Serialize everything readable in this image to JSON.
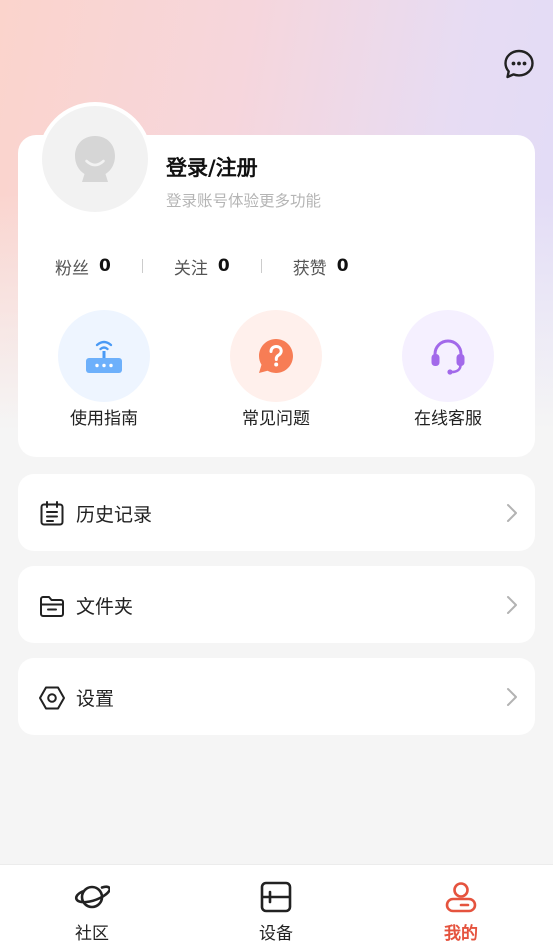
{
  "header": {
    "message_icon": "chat-bubble-icon"
  },
  "profile": {
    "title": "登录/注册",
    "subtitle": "登录账号体验更多功能",
    "avatar_icon": "default-avatar-icon",
    "stats": [
      {
        "label": "粉丝",
        "value": "0"
      },
      {
        "label": "关注",
        "value": "0"
      },
      {
        "label": "获赞",
        "value": "0"
      }
    ]
  },
  "quick_actions": [
    {
      "label": "使用指南",
      "icon": "router-icon",
      "bg": "#eef5ff",
      "color": "#4a9af5"
    },
    {
      "label": "常见问题",
      "icon": "question-bubble-icon",
      "bg": "#fff0ec",
      "color": "#f77d55"
    },
    {
      "label": "在线客服",
      "icon": "headset-icon",
      "bg": "#f5f0ff",
      "color": "#a269ea"
    }
  ],
  "menu": [
    {
      "label": "历史记录",
      "icon": "history-list-icon"
    },
    {
      "label": "文件夹",
      "icon": "folder-icon"
    },
    {
      "label": "设置",
      "icon": "hexagon-settings-icon"
    }
  ],
  "tabs": [
    {
      "label": "社区",
      "icon": "planet-icon",
      "active": false
    },
    {
      "label": "设备",
      "icon": "device-icon",
      "active": false
    },
    {
      "label": "我的",
      "icon": "user-icon",
      "active": true
    }
  ],
  "colors": {
    "accent": "#e5533e",
    "background": "#f5f5f5"
  }
}
